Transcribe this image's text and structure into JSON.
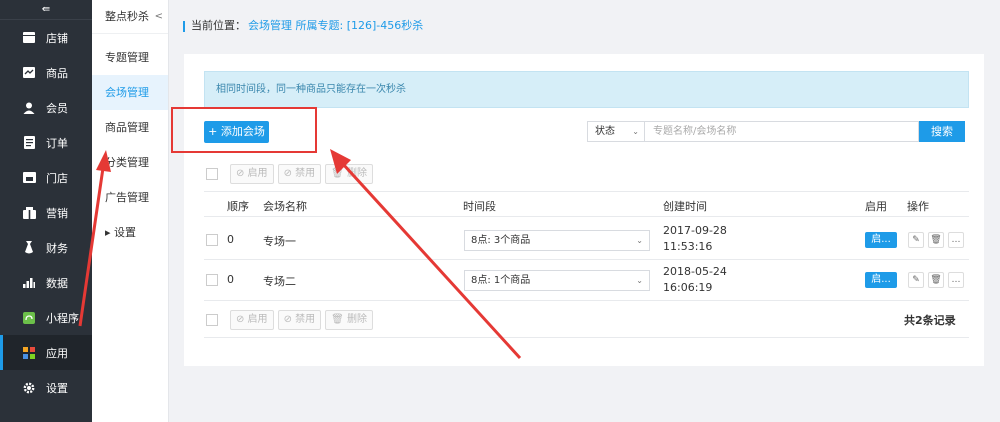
{
  "sidebar": {
    "collapse_label": "⇚",
    "items": [
      {
        "label": "店铺",
        "icon": "shop-icon"
      },
      {
        "label": "商品",
        "icon": "goods-icon"
      },
      {
        "label": "会员",
        "icon": "member-icon"
      },
      {
        "label": "订单",
        "icon": "order-icon"
      },
      {
        "label": "门店",
        "icon": "store-icon"
      },
      {
        "label": "营销",
        "icon": "marketing-icon"
      },
      {
        "label": "财务",
        "icon": "finance-icon"
      },
      {
        "label": "数据",
        "icon": "data-icon"
      },
      {
        "label": "小程序",
        "icon": "miniprogram-icon"
      },
      {
        "label": "应用",
        "icon": "app-icon",
        "active": true
      },
      {
        "label": "设置",
        "icon": "settings-icon"
      }
    ]
  },
  "subnav": {
    "title": "整点秒杀",
    "back": "<",
    "items": [
      {
        "label": "专题管理"
      },
      {
        "label": "会场管理",
        "active": true
      },
      {
        "label": "商品管理"
      },
      {
        "label": "分类管理"
      },
      {
        "label": "广告管理"
      },
      {
        "label": "▸ 设置"
      }
    ]
  },
  "breadcrumb": {
    "prefix": "当前位置：",
    "link": "会场管理 所属专题: [126]-456秒杀"
  },
  "notice": "相同时间段，同一种商品只能存在一次秒杀",
  "toolbar": {
    "add_label": "+ 添加会场",
    "status_label": "状态",
    "search_placeholder": "专题名称/会场名称",
    "search_label": "搜索"
  },
  "bulk_actions": {
    "enable": "⊘ 启用",
    "disable": "⊘ 禁用",
    "delete": "🗑 删除"
  },
  "table": {
    "headers": {
      "order": "顺序",
      "name": "会场名称",
      "period": "时间段",
      "created": "创建时间",
      "enabled": "启用",
      "actions": "操作"
    },
    "rows": [
      {
        "order": "0",
        "name": "专场一",
        "period": "8点: 3个商品",
        "date": "2017-09-28",
        "time": "11:53:16",
        "toggle": "启..."
      },
      {
        "order": "0",
        "name": "专场二",
        "period": "8点: 1个商品",
        "date": "2018-05-24",
        "time": "16:06:19",
        "toggle": "启..."
      }
    ]
  },
  "total": "共2条记录",
  "colors": {
    "accent": "#1e9be8",
    "sidebar": "#2b3139",
    "annotation": "#e53935"
  }
}
